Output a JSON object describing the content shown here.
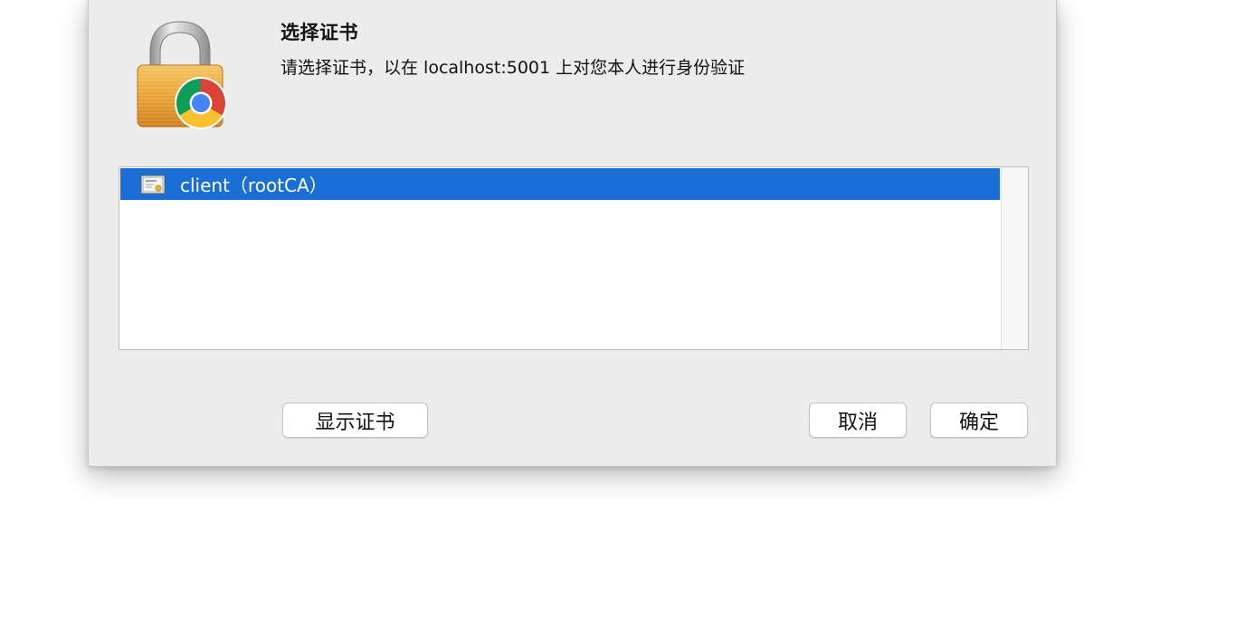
{
  "dialog": {
    "title": "选择证书",
    "message": "请选择证书，以在 localhost:5001 上对您本人进行身份验证"
  },
  "certificates": [
    {
      "label": "client（rootCA）",
      "selected": true
    }
  ],
  "buttons": {
    "show_certificate": "显示证书",
    "cancel": "取消",
    "ok": "确定"
  },
  "colors": {
    "selection": "#1a6fd6",
    "dialog_bg": "#ececec"
  },
  "icons": {
    "app": "lock-with-chrome-icon",
    "certificate": "certificate-icon"
  }
}
